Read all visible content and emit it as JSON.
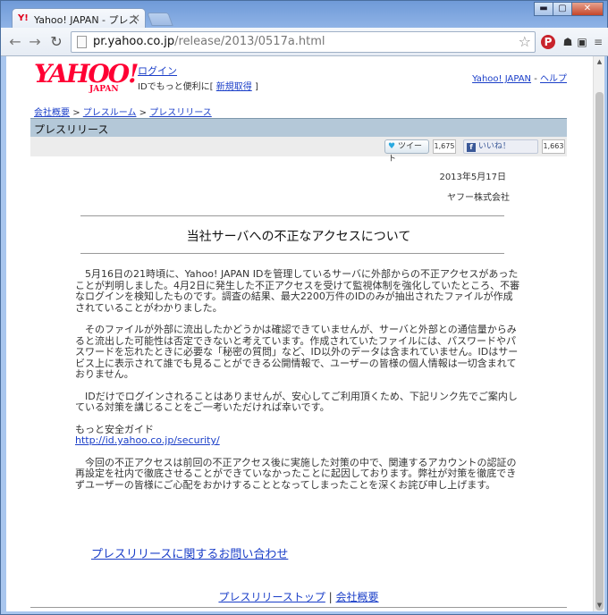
{
  "browser": {
    "tab_title": "Yahoo! JAPAN - プレス",
    "tab_close": "×",
    "url_host": "pr.yahoo.co.jp",
    "url_path": "/release/2013/0517a.html",
    "win_min": "▬",
    "win_max": "▢",
    "win_close": "✕"
  },
  "header": {
    "logo_text": "YAHOO!",
    "logo_sub": "JAPAN",
    "login_link": "ログイン",
    "login_prefix": "IDでもっと便利に[",
    "signup_link": "新規取得",
    "login_suffix": "]",
    "yahoo_japan_link": "Yahoo! JAPAN",
    "separator": " - ",
    "help_link": "ヘルプ"
  },
  "breadcrumb": {
    "items": [
      "会社概要",
      "プレスルーム",
      "プレスリリース"
    ],
    "sep": ">"
  },
  "section_title": "プレスリリース",
  "social": {
    "tweet_label": "ツイート",
    "tweet_count": "1,675",
    "like_label": "いいね！",
    "like_count": "1,663"
  },
  "article": {
    "date": "2013年5月17日",
    "company": "ヤフー株式会社",
    "title": "当社サーバへの不正なアクセスについて",
    "para1": "5月16日の21時頃に、Yahoo! JAPAN IDを管理しているサーバに外部からの不正アクセスがあったことが判明しました。4月2日に発生した不正アクセスを受けて監視体制を強化していたところ、不審なログインを検知したものです。調査の結果、最大2200万件のIDのみが抽出されたファイルが作成されていることがわかりました。",
    "para2": "そのファイルが外部に流出したかどうかは確認できていませんが、サーバと外部との通信量からみると流出した可能性は否定できないと考えています。作成されていたファイルには、パスワードやパスワードを忘れたときに必要な「秘密の質問」など、ID以外のデータは含まれていません。IDはサービス上に表示されて誰でも見ることができる公開情報で、ユーザーの皆様の個人情報は一切含まれておりません。",
    "para3": "IDだけでログインされることはありませんが、安心してご利用頂くため、下記リンク先でご案内している対策を講じることをご一考いただければ幸いです。",
    "guide_label": "もっと安全ガイド",
    "guide_link": "http://id.yahoo.co.jp/security/",
    "para4": "今回の不正アクセスは前回の不正アクセス後に実施した対策の中で、関連するアカウントの認証の再設定を社内で徹底させることができていなかったことに起因しております。弊社が対策を徹底できずユーザーの皆様にご心配をおかけすることとなってしまったことを深くお詫び申し上げます。"
  },
  "contact_link": "プレスリリースに関するお問い合わせ",
  "footer": {
    "top_link": "プレスリリーストップ",
    "sep": " | ",
    "company_link": "会社概要"
  }
}
